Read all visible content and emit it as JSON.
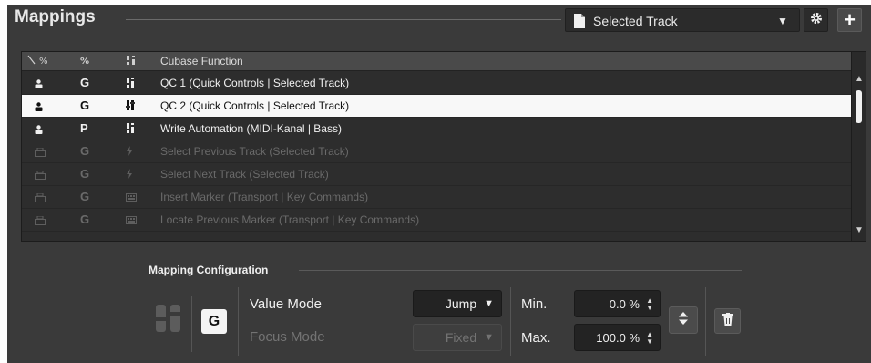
{
  "header": {
    "title": "Mappings",
    "source_dropdown": {
      "value": "Selected Track",
      "icon": "document-icon"
    },
    "settings_icon": "gear-icon",
    "add_icon": "plus-icon"
  },
  "table": {
    "columns": [
      "",
      "",
      "",
      "Cubase Function"
    ],
    "rows": [
      {
        "mode": "G",
        "function": "QC 1 (Quick Controls | Selected Track)",
        "state": "on"
      },
      {
        "mode": "G",
        "function": "QC 2 (Quick Controls | Selected Track)",
        "state": "selected"
      },
      {
        "mode": "P",
        "function": "Write Automation (MIDI-Kanal | Bass)",
        "state": "on"
      },
      {
        "mode": "G",
        "function": "Select Previous Track (Selected Track)",
        "state": "disabled"
      },
      {
        "mode": "G",
        "function": "Select Next Track (Selected Track)",
        "state": "disabled"
      },
      {
        "mode": "G",
        "function": "Insert Marker (Transport | Key Commands)",
        "state": "disabled"
      },
      {
        "mode": "G",
        "function": "Locate Previous Marker (Transport | Key Commands)",
        "state": "disabled"
      }
    ]
  },
  "config": {
    "title": "Mapping Configuration",
    "mode_button": "G",
    "value_mode_label": "Value Mode",
    "value_mode": "Jump",
    "focus_mode_label": "Focus Mode",
    "focus_mode": "Fixed",
    "min_label": "Min.",
    "min_value": "0.0 %",
    "max_label": "Max.",
    "max_value": "100.0 %"
  },
  "colors": {
    "panel": "#3a3a3a",
    "selected_row": "#f8f8f8",
    "disabled_text": "#6a6a6a"
  }
}
